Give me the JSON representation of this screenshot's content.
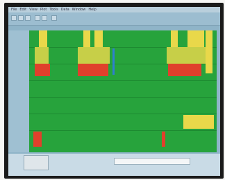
{
  "window": {
    "menu": [
      "File",
      "Edit",
      "View",
      "Plot",
      "Tools",
      "Data",
      "Window",
      "Help"
    ],
    "toolbar_icons": [
      "open-icon",
      "save-icon",
      "print-icon",
      "zoom-in-icon",
      "zoom-out-icon",
      "settings-icon"
    ]
  },
  "rows": [
    {
      "label": ""
    },
    {
      "label": ""
    },
    {
      "label": ""
    },
    {
      "label": ""
    },
    {
      "label": ""
    },
    {
      "label": ""
    },
    {
      "label": ""
    }
  ],
  "colors": {
    "normal": "#27a33c",
    "warning": "#e9d84a",
    "alarm": "#e0402c",
    "marker": "#2f7fd0"
  },
  "status": {
    "left_text": "",
    "right_text": ""
  }
}
